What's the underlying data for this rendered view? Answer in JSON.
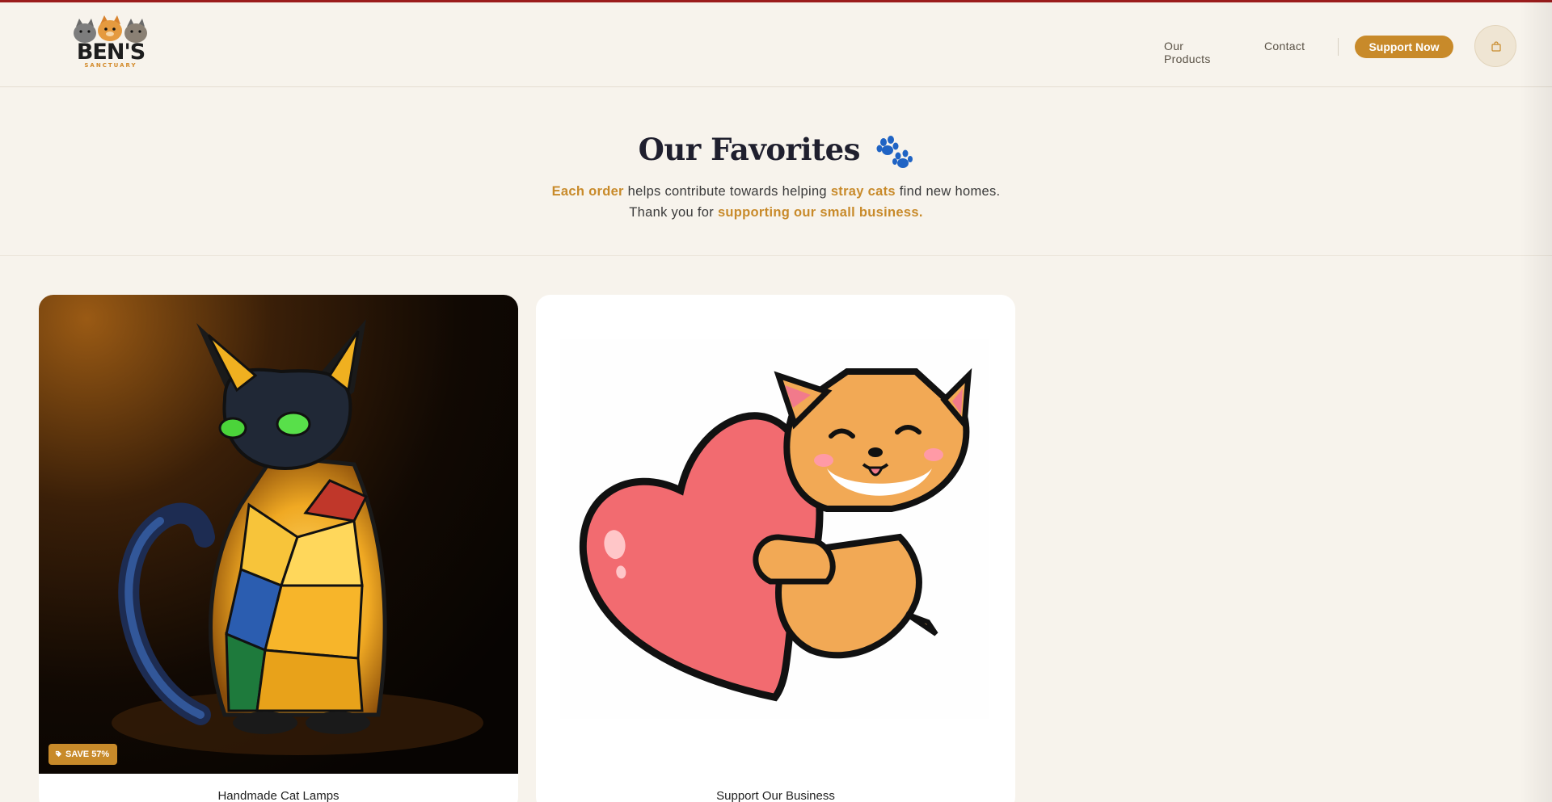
{
  "brand": {
    "name": "BEN'S",
    "tagline": "SANCTUARY"
  },
  "nav": {
    "items": [
      {
        "label": "Our Products"
      },
      {
        "label": "Contact"
      }
    ],
    "support_label": "Support Now",
    "cart_icon": "shopping-bag-icon"
  },
  "hero": {
    "title": "Our Favorites",
    "title_icon": "paw-icon",
    "line1": {
      "highlight1": "Each order",
      "text1": " helps contribute towards helping ",
      "highlight2": "stray cats",
      "text2": " find new homes."
    },
    "line2": {
      "text1": "Thank you for ",
      "highlight1": "supporting our small business."
    }
  },
  "products": [
    {
      "title": "Handmade Cat Lamps",
      "badge": "SAVE 57%",
      "image": "stained-glass-cat-lamp"
    },
    {
      "title": "Support Our Business",
      "image": "cat-hugging-heart"
    }
  ],
  "colors": {
    "accent": "#c88a2a",
    "background": "#f7f3ec",
    "topline": "#9b1c1c",
    "title": "#1f1f2e"
  }
}
